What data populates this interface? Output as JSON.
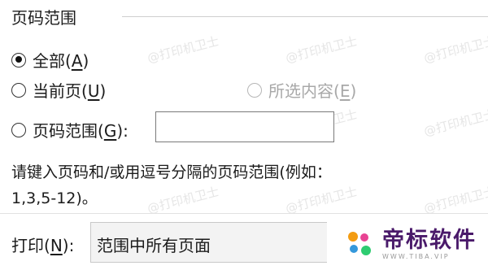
{
  "group": {
    "title": "页码范围"
  },
  "options": {
    "all": {
      "label_text": "全部(",
      "label_key": "A",
      "label_end": ")",
      "checked": true
    },
    "current": {
      "label_text": "当前页(",
      "label_key": "U",
      "label_end": ")",
      "checked": false
    },
    "selection": {
      "label_text": "所选内容(",
      "label_key": "E",
      "label_end": ")",
      "checked": false,
      "disabled": true
    },
    "pages": {
      "label_text": "页码范围(",
      "label_key": "G",
      "label_end": "):",
      "checked": false,
      "value": ""
    }
  },
  "hint": {
    "line1": "请键入页码和/或用逗号分隔的页码范围(例如：",
    "line2": "1,3,5-12)。"
  },
  "print": {
    "label_text": "打印(",
    "label_key": "N",
    "label_end": "):",
    "selected": "范围中所有页面"
  },
  "watermark": {
    "text": "@打印机卫士"
  },
  "logo": {
    "main": "帝标软件",
    "sub": "WWW.TIBA.VIP"
  },
  "colors": {
    "logo_purple": "#4a1a6a",
    "logo_orange": "#f39c12",
    "logo_pink": "#e84393",
    "logo_blue": "#3498db",
    "logo_green": "#2ecc71"
  }
}
